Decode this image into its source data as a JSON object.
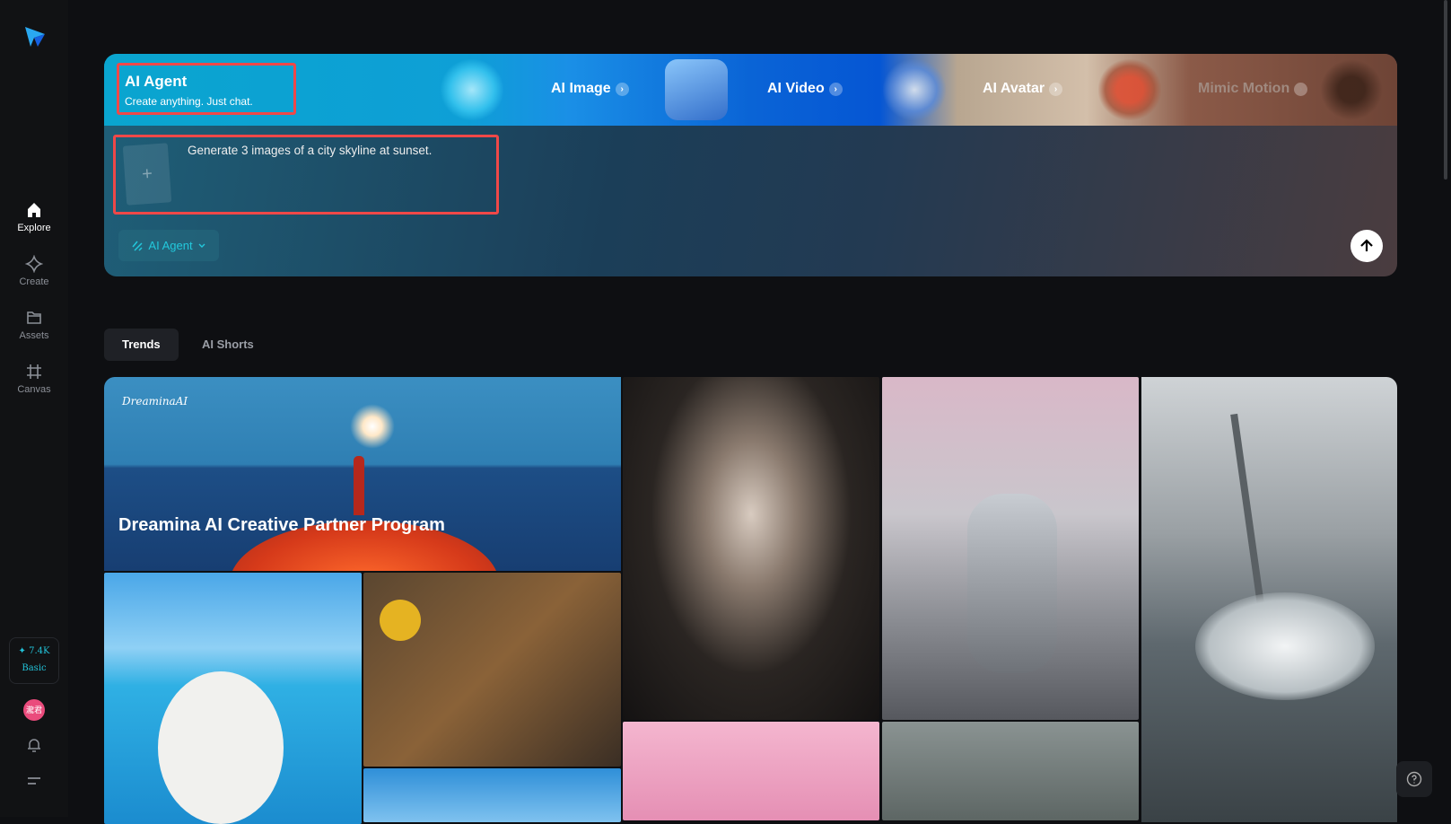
{
  "sidebar": {
    "items": [
      {
        "label": "Explore",
        "icon": "home-icon"
      },
      {
        "label": "Create",
        "icon": "diamond-icon"
      },
      {
        "label": "Assets",
        "icon": "folder-icon"
      },
      {
        "label": "Canvas",
        "icon": "crop-icon"
      }
    ],
    "credits": {
      "amount": "✦ 7.4K",
      "plan": "Basic"
    },
    "avatar_text": "瀧君"
  },
  "banner": {
    "agent": {
      "title": "AI Agent",
      "subtitle": "Create anything. Just chat."
    },
    "features": [
      {
        "label": "AI Image"
      },
      {
        "label": "AI Video"
      },
      {
        "label": "AI Avatar"
      },
      {
        "label": "Mimic Motion"
      }
    ],
    "prompt": "Generate 3 images of a city skyline at sunset.",
    "mode": "AI Agent"
  },
  "tabs": [
    {
      "label": "Trends"
    },
    {
      "label": "AI Shorts"
    }
  ],
  "gallery": {
    "hero": {
      "brand": "DreaminaAI",
      "title": "Dreamina AI Creative Partner Program"
    }
  },
  "colors": {
    "accent": "#22c3d9",
    "highlight": "#f04848"
  }
}
